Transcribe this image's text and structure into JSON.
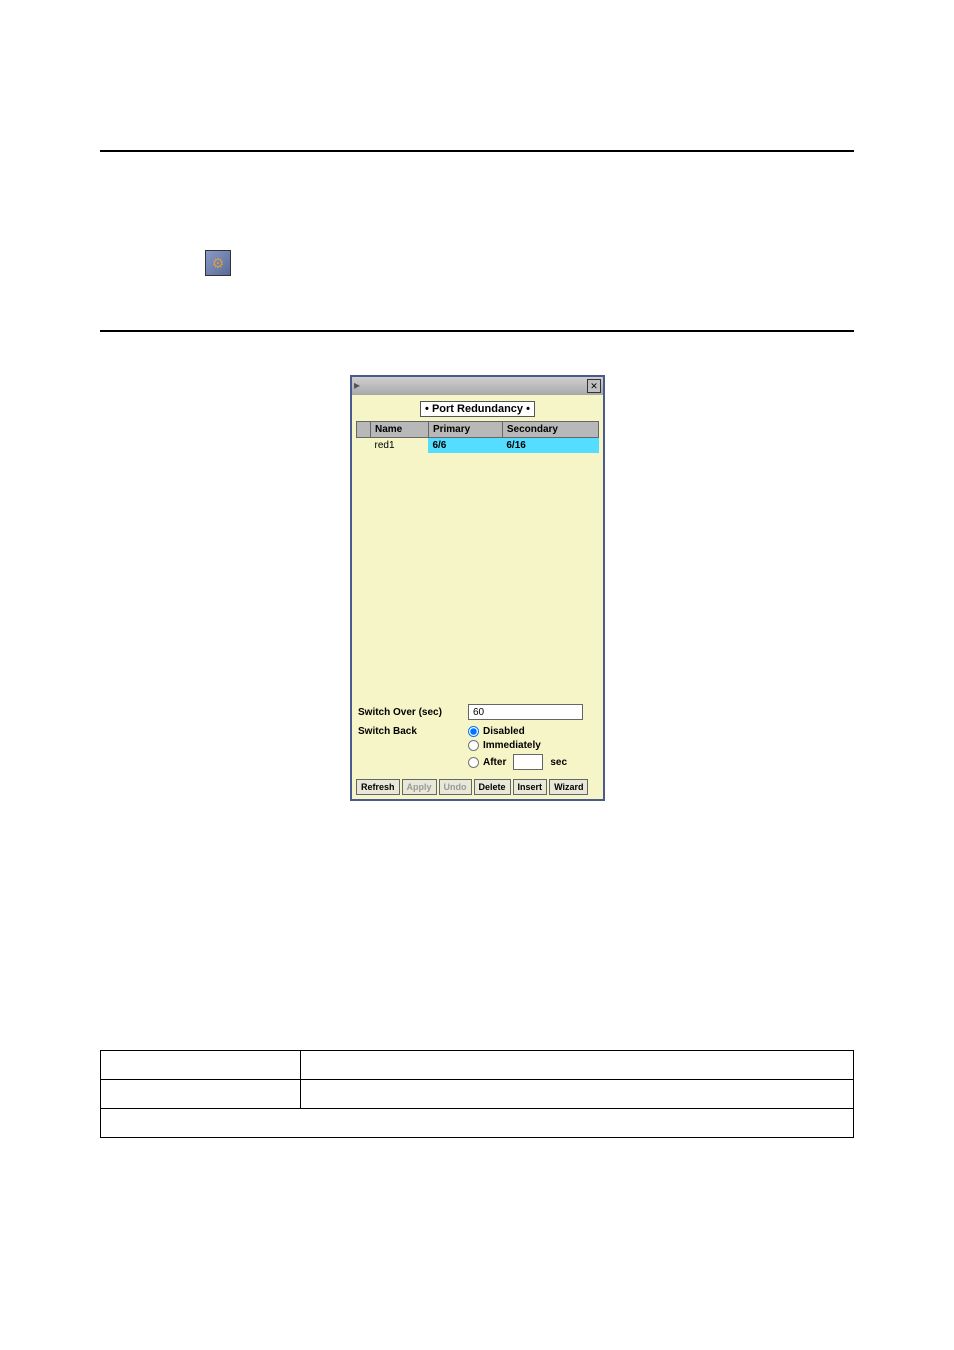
{
  "dialog": {
    "title": "• Port Redundancy •",
    "columns": {
      "name": "Name",
      "primary": "Primary",
      "secondary": "Secondary"
    },
    "rows": [
      {
        "name": "red1",
        "primary": "6/6",
        "secondary": "6/16"
      }
    ],
    "switchOverLabel": "Switch Over (sec)",
    "switchOverValue": "60",
    "switchBackLabel": "Switch Back",
    "switchBackOptions": {
      "disabled": "Disabled",
      "immediately": "Immediately",
      "after": "After",
      "afterUnit": "sec",
      "afterValue": ""
    },
    "switchBackSelected": "disabled",
    "buttons": {
      "refresh": "Refresh",
      "apply": "Apply",
      "undo": "Undo",
      "delete": "Delete",
      "insert": "Insert",
      "wizard": "Wizard"
    }
  }
}
